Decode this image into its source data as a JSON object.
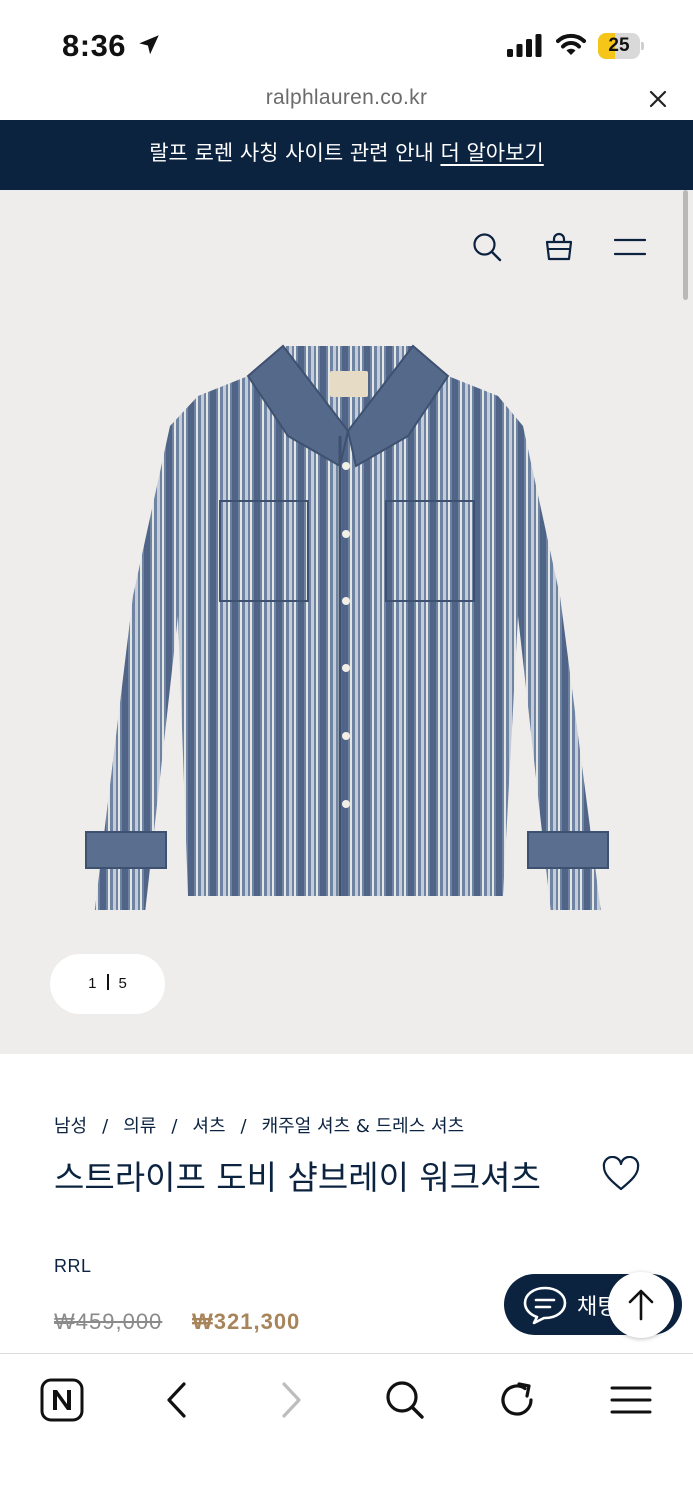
{
  "status_bar": {
    "time": "8:36",
    "battery_level": "25",
    "battery_percent": 25,
    "icons": [
      "location-arrow-icon",
      "signal-icon",
      "wifi-icon",
      "battery-icon"
    ]
  },
  "url_bar": {
    "domain": "ralphlauren.co.kr",
    "close_icon": "close-icon"
  },
  "banner": {
    "text": "랄프 로렌 사칭 사이트 관련 안내",
    "link": "더 알아보기"
  },
  "hero": {
    "icons": [
      "search-icon",
      "shopping-bag-icon",
      "menu-icon"
    ],
    "pager": {
      "current": "1",
      "total": "5"
    }
  },
  "product": {
    "breadcrumb": [
      "남성",
      "의류",
      "셔츠",
      "캐주얼 셔츠 & 드레스 셔츠"
    ],
    "breadcrumb_sep": "/",
    "title": "스트라이프 도비 샴브레이 워크셔츠",
    "brand": "RRL",
    "price_original": "₩459,000",
    "price_sale": "₩321,300",
    "wishlist_icon": "heart-icon"
  },
  "chat": {
    "label": "채팅"
  },
  "bottom_bar": {
    "icons": [
      "naver-logo-icon",
      "back-icon",
      "forward-icon",
      "search-icon",
      "reload-icon",
      "menu-icon"
    ]
  },
  "colors": {
    "navy": "#0c2340",
    "sale_gold": "#a8845a",
    "hero_bg": "#efedeb",
    "battery_yellow": "#f5c518"
  }
}
